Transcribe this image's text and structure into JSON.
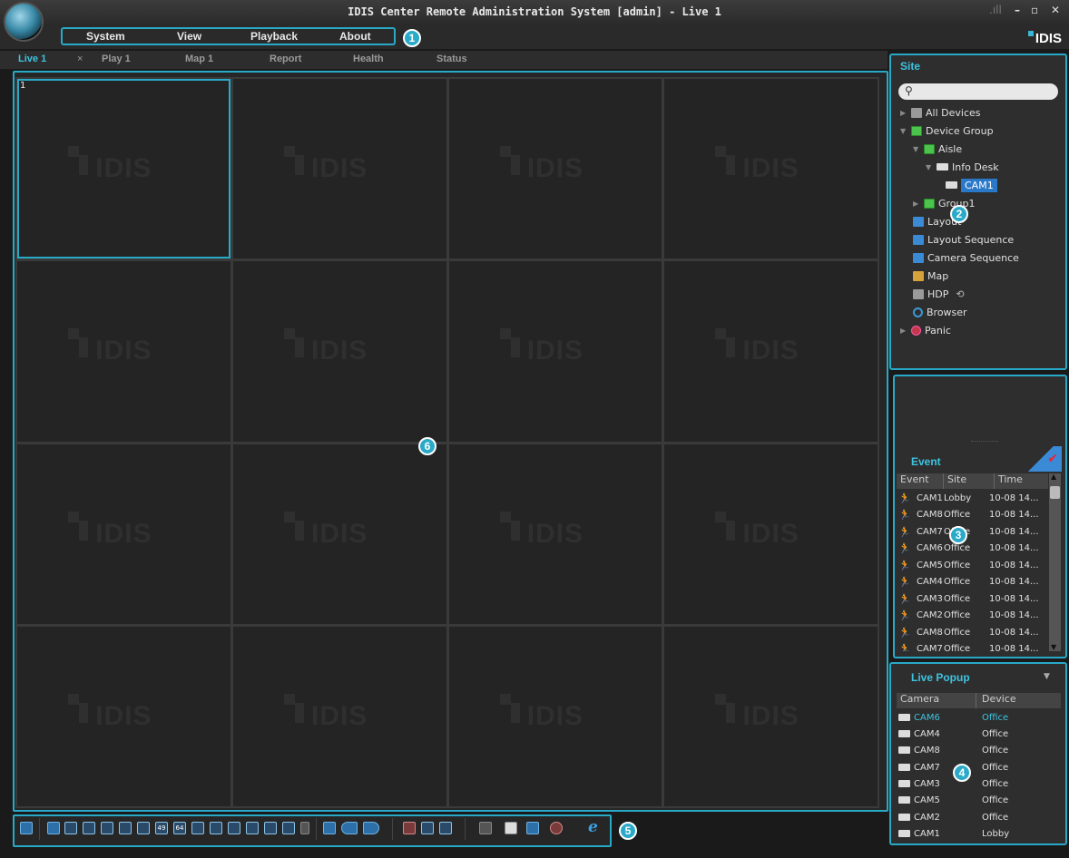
{
  "window": {
    "title": "IDIS Center Remote Administration System [admin] - Live 1",
    "signal": ".ıll",
    "minimize": "–",
    "restore": "▫",
    "close": "✕"
  },
  "brand": "IDIS",
  "menu": [
    "System",
    "View",
    "Playback",
    "About"
  ],
  "tabs": [
    {
      "label": "Live 1",
      "active": true,
      "close": "×"
    },
    {
      "label": "Play 1"
    },
    {
      "label": "Map 1"
    },
    {
      "label": "Report"
    },
    {
      "label": "Health"
    },
    {
      "label": "Status"
    }
  ],
  "badges": [
    "1",
    "2",
    "3",
    "4",
    "5",
    "6"
  ],
  "grid": {
    "cell_number": "1",
    "watermark": "IDIS"
  },
  "site_panel": {
    "title": "Site",
    "search_icon": "search-icon",
    "tree": [
      {
        "label": "All Devices",
        "icon": "devices-icon",
        "expander": "▶"
      },
      {
        "label": "Device Group",
        "icon": "group-cube-icon",
        "expander": "▼"
      },
      {
        "label": "Aisle",
        "icon": "group-cube-icon",
        "expander": "▼"
      },
      {
        "label": "Info Desk",
        "icon": "camera-device-icon",
        "expander": "▼"
      },
      {
        "label": "CAM1",
        "icon": "camera-icon",
        "selected": true
      },
      {
        "label": "Group1",
        "icon": "group-cube-icon",
        "expander": "▶"
      },
      {
        "label": "Layout",
        "icon": "layout-icon"
      },
      {
        "label": "Layout Sequence",
        "icon": "layout-sequence-icon"
      },
      {
        "label": "Camera Sequence",
        "icon": "camera-sequence-icon"
      },
      {
        "label": "Map",
        "icon": "map-icon"
      },
      {
        "label": "HDP",
        "icon": "hdp-icon"
      },
      {
        "label": "Browser",
        "icon": "browser-icon"
      },
      {
        "label": "Panic",
        "icon": "panic-icon",
        "expander": "▶"
      }
    ],
    "refresh": "⟲"
  },
  "event_panel": {
    "title": "Event",
    "columns": [
      "Event",
      "Site",
      "Time"
    ],
    "rows": [
      {
        "cam": "CAM1",
        "site": "Lobby",
        "time": "10-08 14..."
      },
      {
        "cam": "CAM8",
        "site": "Office",
        "time": "10-08 14..."
      },
      {
        "cam": "CAM7",
        "site": "Office",
        "time": "10-08 14..."
      },
      {
        "cam": "CAM6",
        "site": "Office",
        "time": "10-08 14..."
      },
      {
        "cam": "CAM5",
        "site": "Office",
        "time": "10-08 14..."
      },
      {
        "cam": "CAM4",
        "site": "Office",
        "time": "10-08 14..."
      },
      {
        "cam": "CAM3",
        "site": "Office",
        "time": "10-08 14..."
      },
      {
        "cam": "CAM2",
        "site": "Office",
        "time": "10-08 14..."
      },
      {
        "cam": "CAM8",
        "site": "Office",
        "time": "10-08 14..."
      },
      {
        "cam": "CAM7",
        "site": "Office",
        "time": "10-08 14..."
      }
    ],
    "scroll_up": "▲",
    "scroll_down": "▼"
  },
  "live_popup": {
    "title": "Live Popup",
    "dropdown": "▼",
    "columns": [
      "Camera",
      "Device"
    ],
    "rows": [
      {
        "camera": "CAM6",
        "device": "Office",
        "highlight": true
      },
      {
        "camera": "CAM4",
        "device": "Office"
      },
      {
        "camera": "CAM8",
        "device": "Office"
      },
      {
        "camera": "CAM7",
        "device": "Office"
      },
      {
        "camera": "CAM3",
        "device": "Office"
      },
      {
        "camera": "CAM5",
        "device": "Office"
      },
      {
        "camera": "CAM2",
        "device": "Office"
      },
      {
        "camera": "CAM1",
        "device": "Lobby"
      }
    ]
  },
  "toolbar": {
    "layout_labels": [
      "49",
      "64"
    ],
    "browser_glyph": "e"
  }
}
